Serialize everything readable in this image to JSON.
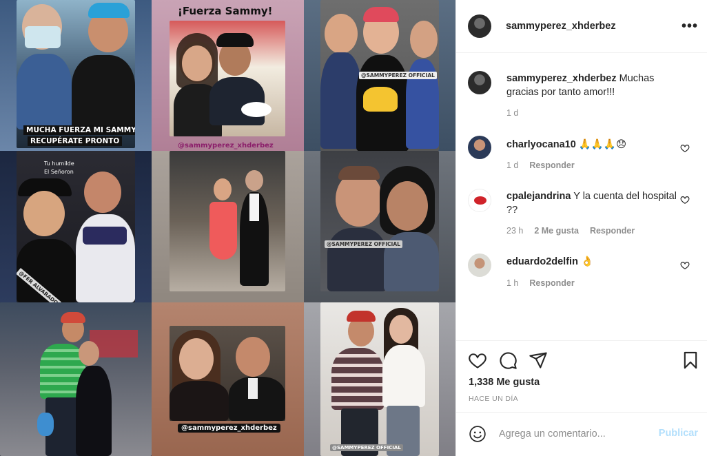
{
  "collage": {
    "tiles": [
      {
        "caption_1": "MUCHA FUERZA MI SAMMY",
        "caption_2": "RECUPÉRATE PRONTO"
      },
      {
        "caption_1": "¡Fuerza Sammy!",
        "caption_2": "@sammyperez_xhderbez"
      },
      {
        "caption_1": "@SAMMYPEREZ OFFICIAL"
      },
      {
        "caption_1": "Tu humilde",
        "caption_2": "El Señoron",
        "caption_3": "@FER ALVARADO"
      },
      {},
      {
        "caption_1": "@SAMMYPEREZ OFFICIAL"
      },
      {},
      {
        "caption_1": "@sammyperez_xhderbez"
      },
      {
        "caption_1": "@SAMMYPEREZ OFFICIAL"
      }
    ]
  },
  "post": {
    "author": "sammyperez_xhderbez",
    "more_icon": "more-horizontal-icon",
    "caption": {
      "author": "sammyperez_xhderbez",
      "text": "Muchas gracias por tanto amor!!!",
      "time": "1 d"
    },
    "comments": [
      {
        "user": "charlyocana10",
        "text": "🙏🙏🙏😞",
        "time": "1 d",
        "reply": "Responder"
      },
      {
        "user": "cpalejandrina",
        "text": "Y la cuenta del hospital ??",
        "time": "23 h",
        "likes": "2 Me gusta",
        "reply": "Responder"
      },
      {
        "user": "eduardo2delfin",
        "text": "👌",
        "time": "1 h",
        "reply": "Responder"
      }
    ],
    "likes": "1,338 Me gusta",
    "posted_ago": "HACE UN DÍA",
    "add_comment_placeholder": "Agrega un comentario...",
    "publish_label": "Publicar"
  },
  "colors": {
    "text": "#262626",
    "muted": "#8e8e8e",
    "border": "#efefef",
    "publish_disabled": "#b2dffc"
  }
}
